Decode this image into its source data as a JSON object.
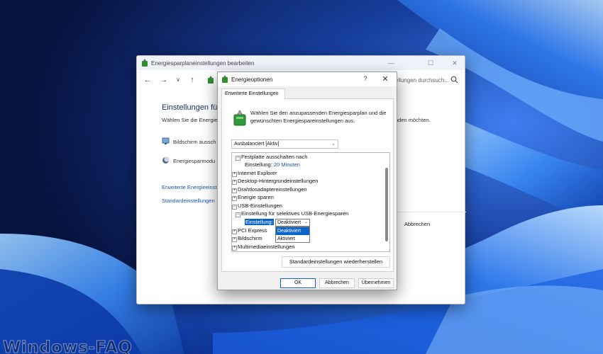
{
  "background_window": {
    "title": "Energiesparplaneinstellungen bearbeiten",
    "nav": {
      "back": "←",
      "forward": "→",
      "dropdown": "∨",
      "up": "↑"
    },
    "search_placeholder": "Einstellungen durchsuch...",
    "heading": "Einstellungen für",
    "description": "Wählen Sie die Energie",
    "description_end": "nden möchten.",
    "rows": [
      "Bildschirm aussch",
      "Energiesparmodu"
    ],
    "links": [
      "Erweiterte Energieeinst",
      "Standardeinstellungen"
    ],
    "cancel_label": "Abbrechen"
  },
  "dialog": {
    "title": "Energieoptionen",
    "help": "?",
    "close": "✕",
    "tab": "Erweiterte Einstellungen",
    "description": "Wählen Sie den anzupassenden Energiesparplan und die gewünschten Energiespareinstellungen aus.",
    "plan_selected": "Ausbalanciert [Aktiv]",
    "tree": {
      "festplatte": "Festplatte ausschalten nach",
      "festplatte_setting_label": "Einstellung:",
      "festplatte_setting_value": "20 Minuten",
      "internet_explorer": "Internet Explorer",
      "desktop": "Desktop-Hintergrundeinstellungen",
      "drahtlos": "Drahtlosadaptereinstellungen",
      "energie": "Energie sparen",
      "usb": "USB-Einstellungen",
      "usb_selective": "Einstellung für selektives USB-Energiesparen",
      "usb_setting_label": "Einstellung:",
      "pci": "PCI Express",
      "bildschirm": "Bildschirm",
      "multimedia": "Multimediaeinstellungen"
    },
    "combo_value": "Deaktiviert",
    "dropdown_options": [
      "Deaktiviert",
      "Aktiviert"
    ],
    "restore_button": "Standardeinstellungen wiederherstellen",
    "ok_button": "OK",
    "cancel_button": "Abbrechen",
    "apply_button": "Übernehmen"
  },
  "watermark": "Windows-FAQ",
  "colors": {
    "accent": "#0a64c9",
    "link": "#1a56b0",
    "wallpaper": "#0a1f57"
  }
}
